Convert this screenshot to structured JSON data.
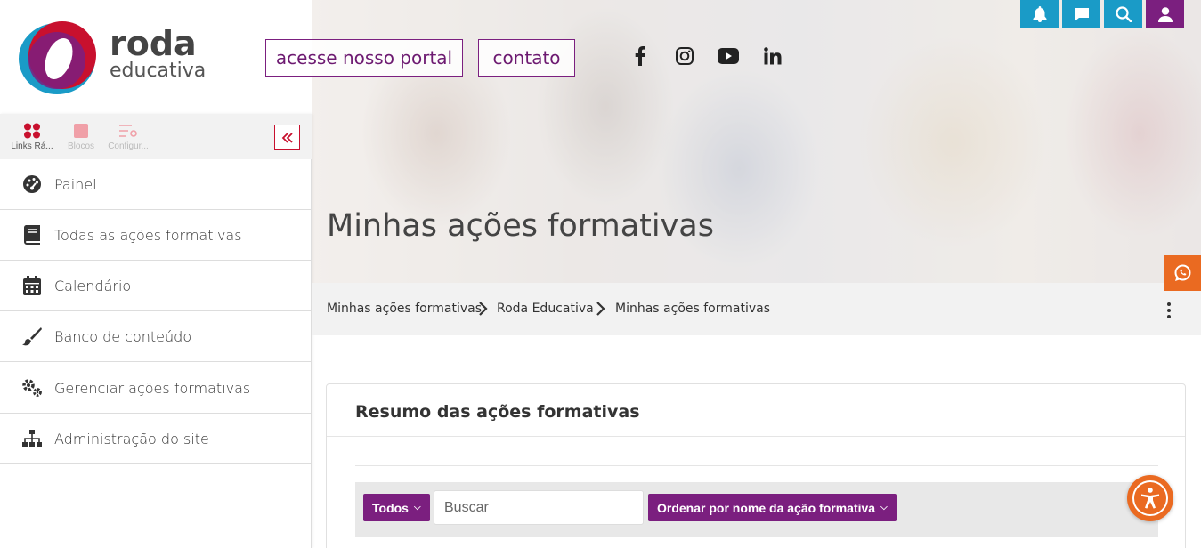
{
  "brand": {
    "name": "roda",
    "subtitle": "educativa"
  },
  "header": {
    "portal_label": "acesse nosso portal",
    "contact_label": "contato",
    "social": [
      "facebook-icon",
      "instagram-icon",
      "youtube-icon",
      "linkedin-icon"
    ],
    "utility": [
      "bell-icon",
      "chat-icon",
      "search-icon",
      "user-icon"
    ],
    "utility_color": "#1a9bc7"
  },
  "drawer": {
    "tabs": [
      {
        "label": "Links Rá...",
        "icon": "links-icon"
      },
      {
        "label": "Blocos",
        "icon": "blocks-icon"
      },
      {
        "label": "Configur...",
        "icon": "settings-icon"
      }
    ]
  },
  "sidebar": {
    "items": [
      {
        "label": "Painel",
        "icon": "dashboard-icon"
      },
      {
        "label": "Todas as ações formativas",
        "icon": "book-icon"
      },
      {
        "label": "Calendário",
        "icon": "calendar-icon"
      },
      {
        "label": "Banco de conteúdo",
        "icon": "brush-icon"
      },
      {
        "label": "Gerenciar ações formativas",
        "icon": "cogs-icon"
      },
      {
        "label": "Administração do site",
        "icon": "sitemap-icon"
      }
    ]
  },
  "page": {
    "title": "Minhas ações formativas"
  },
  "breadcrumb": [
    "Minhas ações formativas",
    "Roda Educativa",
    "Minhas ações formativas"
  ],
  "card": {
    "title": "Resumo das ações formativas",
    "filter_label": "Todos",
    "search_placeholder": "Buscar",
    "sort_label": "Ordenar por nome da ação formativa"
  },
  "colors": {
    "primary": "#7b1f7f",
    "accent": "#ea6a21",
    "info": "#1a9bc7",
    "danger": "#c8102e"
  }
}
